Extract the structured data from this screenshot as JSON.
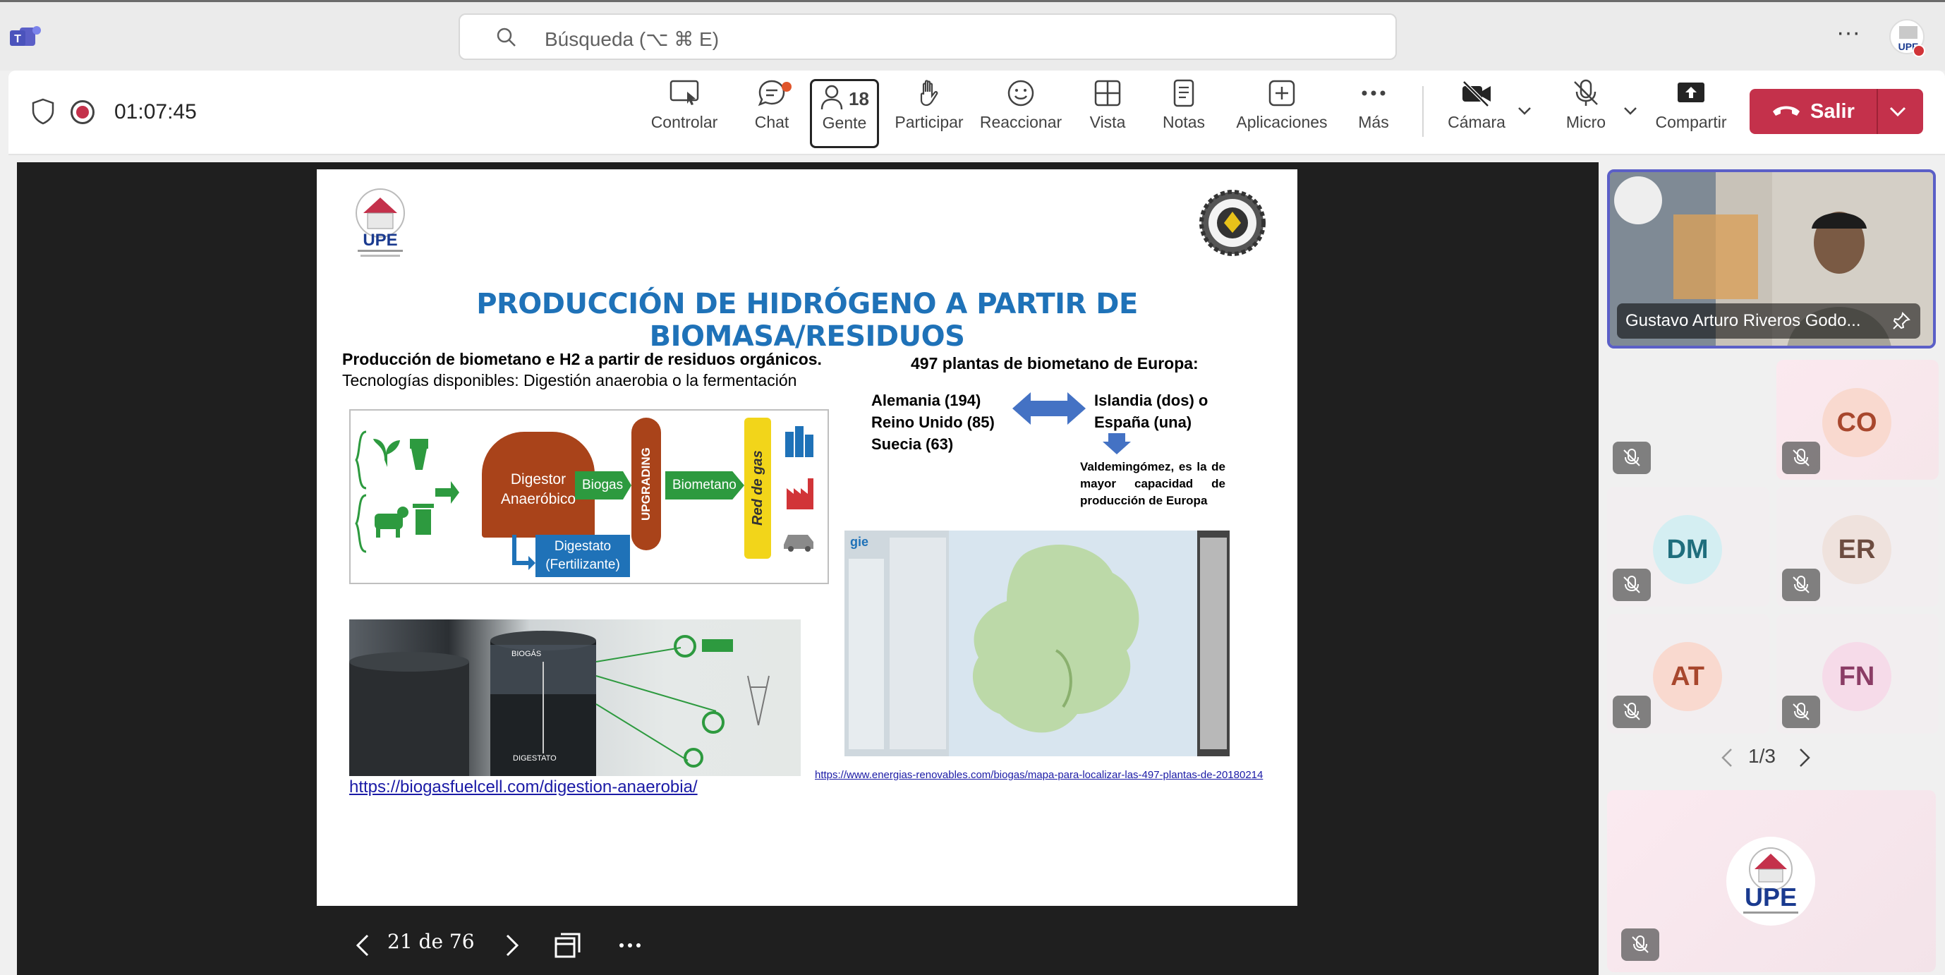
{
  "search": {
    "placeholder": "Búsqueda (⌥ ⌘ E)"
  },
  "meeting": {
    "timer": "01:07:45",
    "toolbar": {
      "controlar": "Controlar",
      "chat": "Chat",
      "gente": "Gente",
      "gente_count": "18",
      "participar": "Participar",
      "reaccionar": "Reaccionar",
      "vista": "Vista",
      "notas": "Notas",
      "aplicaciones": "Aplicaciones",
      "mas": "Más",
      "camara": "Cámara",
      "micro": "Micro",
      "compartir": "Compartir",
      "salir": "Salir"
    }
  },
  "slide": {
    "logo_text": "UPE",
    "title": "PRODUCCIÓN DE HIDRÓGENO A PARTIR DE BIOMASA/RESIDUOS",
    "subtitle_bold": "Producción de biometano e H2 a partir de residuos orgánicos.",
    "subtitle": "Tecnologías disponibles: Digestión anaerobia o la fermentación",
    "diagram": {
      "digestor": "Digestor Anaeróbico",
      "biogas": "Biogas",
      "upgrading": "UPGRADING",
      "biometano": "Biometano",
      "red_gas": "Red de gas",
      "digestato": "Digestato (Fertilizante)"
    },
    "plant_labels": {
      "biogas": "BIOGÁS",
      "digestato": "DIGESTATO"
    },
    "link1": "https://biogasfuelcell.com/digestion-anaerobia/",
    "plantas_heading": "497 plantas de biometano de Europa:",
    "countries_left": [
      "Alemania (194)",
      "Reino Unido (85)",
      "Suecia (63)"
    ],
    "countries_right": [
      "Islandia (dos) o",
      "España (una)"
    ],
    "valdemingomez": "Valdemingómez, es la de mayor capacidad de producción de Europa",
    "map_brand": "gie",
    "link2": "https://www.energias-renovables.com/biogas/mapa-para-localizar-las-497-plantas-de-20180214"
  },
  "slide_controls": {
    "page": "21 de 76"
  },
  "participants": {
    "featured_name": "Gustavo Arturo Riveros Godo...",
    "tiles": [
      {
        "initials": "",
        "color": "#ffffff",
        "text_color": "#ffffff"
      },
      {
        "initials": "CO",
        "color": "#f9d9cf",
        "text_color": "#a8472d"
      },
      {
        "initials": "DM",
        "color": "#d4eef2",
        "text_color": "#1f6e7d"
      },
      {
        "initials": "ER",
        "color": "#efe2dd",
        "text_color": "#6d4c40"
      },
      {
        "initials": "AT",
        "color": "#f9d9cf",
        "text_color": "#a8472d"
      },
      {
        "initials": "FN",
        "color": "#f6dbe9",
        "text_color": "#8b3d66"
      }
    ],
    "pager": "1/3",
    "bottom_logo": "UPE"
  },
  "colors": {
    "accent": "#5b5fc7",
    "leave": "#c4314b",
    "slide_title": "#1f72b8"
  }
}
